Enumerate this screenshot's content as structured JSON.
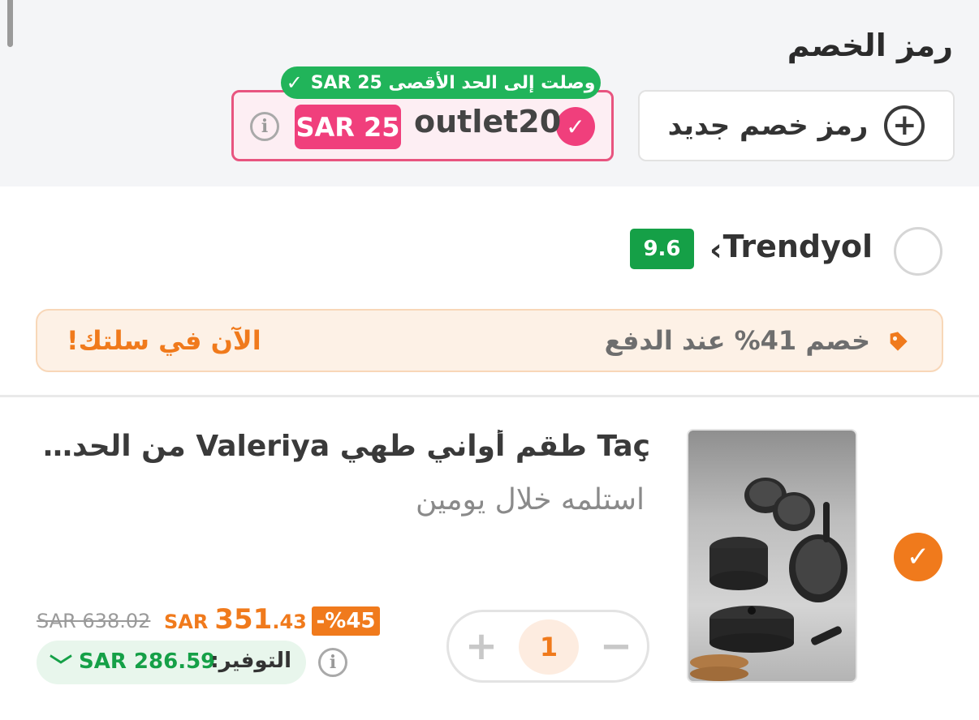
{
  "coupon": {
    "title": "رمز الخصم",
    "new_code_label": "رمز خصم جديد",
    "applied_code": "outlet20",
    "applied_amount": "SAR 25",
    "max_reached_text": "وصلت إلى الحد الأقصى SAR 25"
  },
  "seller": {
    "name": "Trendyol",
    "rating": "9.6"
  },
  "promo": {
    "text": "خصم 41% عند الدفع",
    "cta": "الآن في سلتك!"
  },
  "product": {
    "title": "Taç طقم أواني طهي Valeriya من الحديد الزهر",
    "delivery": "استلمه خلال يومين",
    "quantity": "1",
    "discount_badge": "%45-",
    "price_currency": "SAR",
    "price_integer": "351",
    "price_decimal": ".43",
    "old_price": "SAR 638.02",
    "savings_label": "التوفير:",
    "savings_amount": "SAR 286.59"
  },
  "colors": {
    "accent_orange": "#f07a1c",
    "coupon_pink": "#f03f7c",
    "success_green": "#21b45a",
    "rating_green": "#15a047"
  },
  "icons": [
    "plus-circle-icon",
    "check-icon",
    "info-icon",
    "chevron-left-icon",
    "tag-icon",
    "chevron-down-icon"
  ]
}
